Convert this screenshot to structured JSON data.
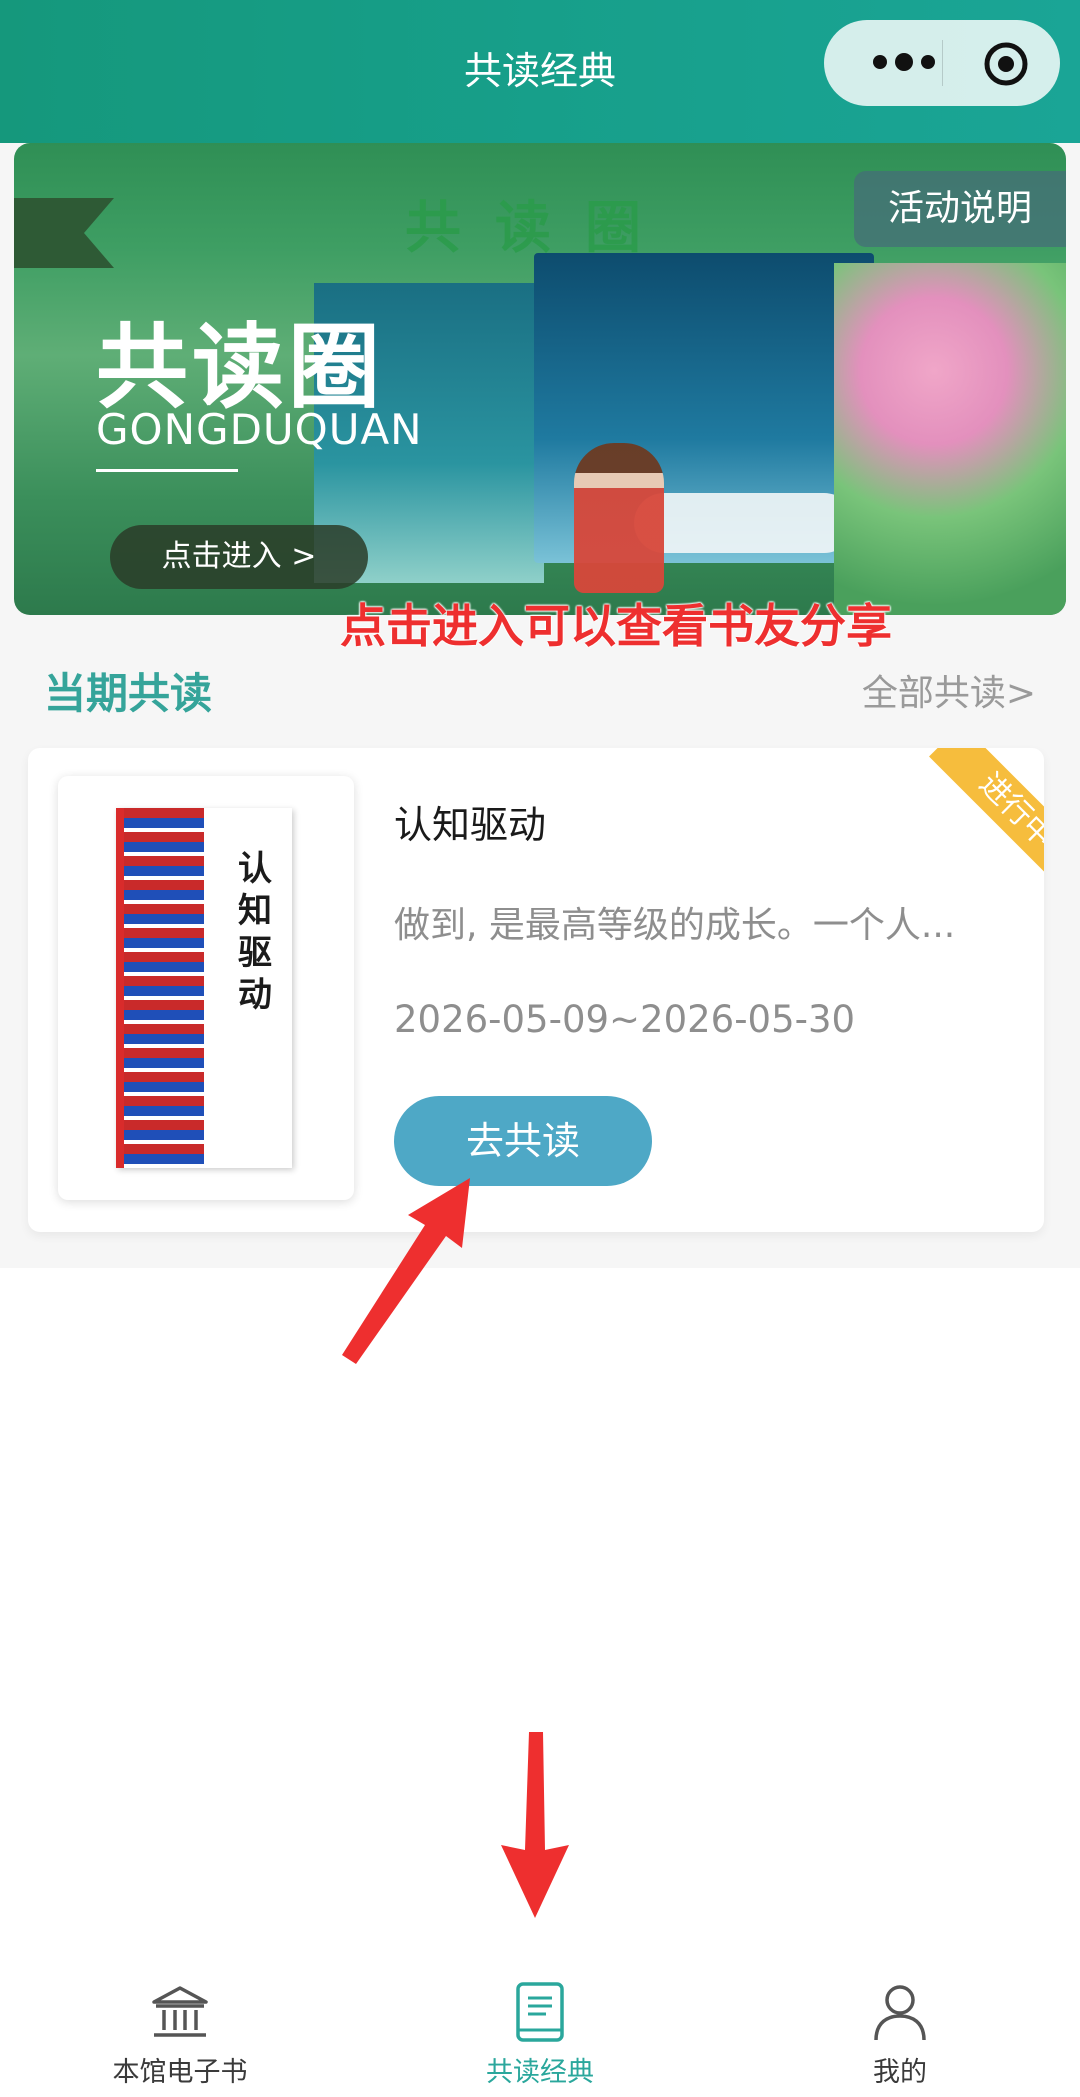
{
  "header": {
    "title": "共读经典",
    "more_icon": "more-dots-icon",
    "close_icon": "target-circle-icon"
  },
  "banner": {
    "top_title": "共读圈",
    "activity_label": "活动说明",
    "main_title": "共读圈",
    "subtitle": "GONGDUQUAN",
    "enter_label": "点击进入 >"
  },
  "annotations": {
    "enter_hint": "点击进入可以查看书友分享",
    "color": "#ee2f2f"
  },
  "section": {
    "title": "当期共读",
    "all_link": "全部共读>"
  },
  "book": {
    "title": "认知驱动",
    "description": "做到, 是最高等级的成长。一个人...",
    "date_range": "2026-05-09~2026-05-30",
    "status_badge": "进行中",
    "button_label": "去共读",
    "cover_title": "认知驱动"
  },
  "tabbar": {
    "items": [
      {
        "label": "本馆电子书",
        "icon": "library-building-icon",
        "active": false
      },
      {
        "label": "共读经典",
        "icon": "book-icon",
        "active": true
      },
      {
        "label": "我的",
        "icon": "user-icon",
        "active": false
      }
    ],
    "active_color": "#2aa79c"
  },
  "colors": {
    "header": "#179f8a",
    "accent": "#35a49a",
    "button": "#4ea8c6",
    "badge": "#f6bd3d"
  }
}
